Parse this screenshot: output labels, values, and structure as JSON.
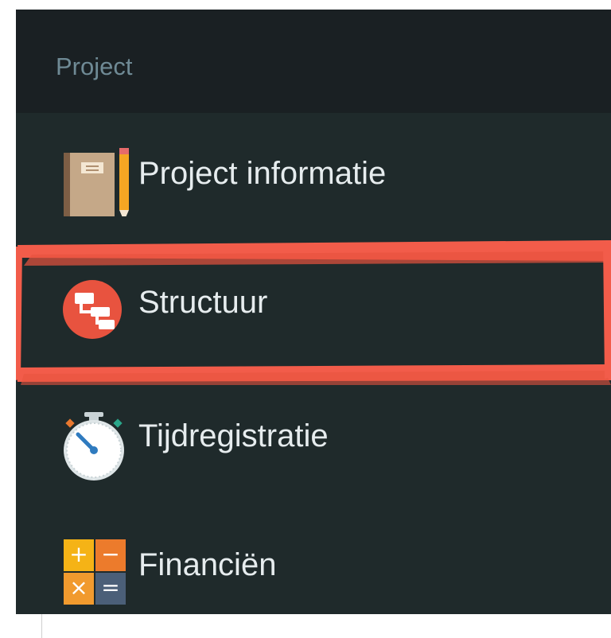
{
  "sidebar": {
    "header": "Project",
    "items": [
      {
        "label": "Project informatie",
        "icon": "notebook-icon"
      },
      {
        "label": "Structuur",
        "icon": "structure-icon"
      },
      {
        "label": "Tijdregistratie",
        "icon": "stopwatch-icon"
      },
      {
        "label": "Financiën",
        "icon": "calculator-icon"
      }
    ],
    "highlighted_item": "Structuur"
  },
  "colors": {
    "panel_bg": "#1f2a2b",
    "header_bg": "#1a2023",
    "text": "#e6ecee",
    "header_text": "#6f8a95",
    "highlight": "#f25c4a"
  }
}
